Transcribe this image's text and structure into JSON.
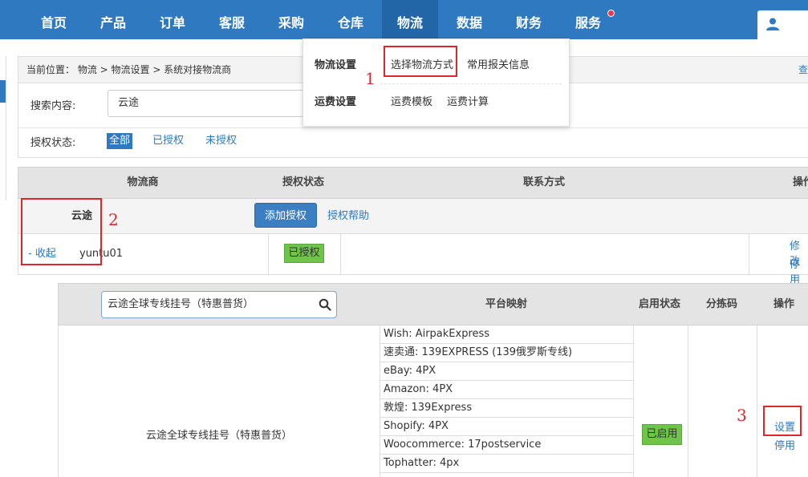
{
  "nav": {
    "items": [
      "首页",
      "产品",
      "订单",
      "客服",
      "采购",
      "仓库",
      "物流",
      "数据",
      "财务",
      "服务"
    ],
    "active": "物流"
  },
  "breadcrumb": {
    "text": "当前位置：  物流 >  物流设置 > 系统对接物流商",
    "right_text": "查"
  },
  "search": {
    "label": "搜索内容:",
    "value": "云途",
    "status_label": "授权状态:",
    "filters": [
      "全部",
      "已授权",
      "未授权"
    ]
  },
  "table": {
    "headers": [
      "物流商",
      "授权状态",
      "联系方式",
      "操作"
    ],
    "carrier": "云途",
    "add_auth_button": "添加授权",
    "auth_help": "授权帮助",
    "collapse": "- 收起",
    "account": "yuntu01",
    "auth_status": "已授权",
    "ops": [
      "修改",
      "停用"
    ]
  },
  "subtable": {
    "search_value": "云途全球专线挂号（特惠普货）",
    "headers": [
      "平台映射",
      "启用状态",
      "分拣码",
      "操作"
    ],
    "route_name": "云途全球专线挂号（特惠普货）",
    "mappings": [
      "Wish:  AirpakExpress",
      "速卖通:  139EXPRESS (139俄罗斯专线)",
      "eBay:  4PX",
      "Amazon:  4PX",
      "敦煌:  139Express",
      "Shopify:  4PX",
      "Woocommerce:  17postservice",
      "Tophatter:  4px"
    ],
    "enabled_status": "已启用",
    "ops": [
      "设置",
      "停用"
    ]
  },
  "dropdown": {
    "group1": "物流设置",
    "group1_items": [
      "选择物流方式",
      "常用报关信息"
    ],
    "group2": "运费设置",
    "group2_items": [
      "运费模板",
      "运费计算"
    ]
  },
  "annotations": [
    "1",
    "2",
    "3"
  ],
  "colors": {
    "nav_bg": "#2f79c0",
    "nav_active": "#2366a8",
    "badge_green": "#6fc44a",
    "annotation_red": "#e0262b"
  }
}
